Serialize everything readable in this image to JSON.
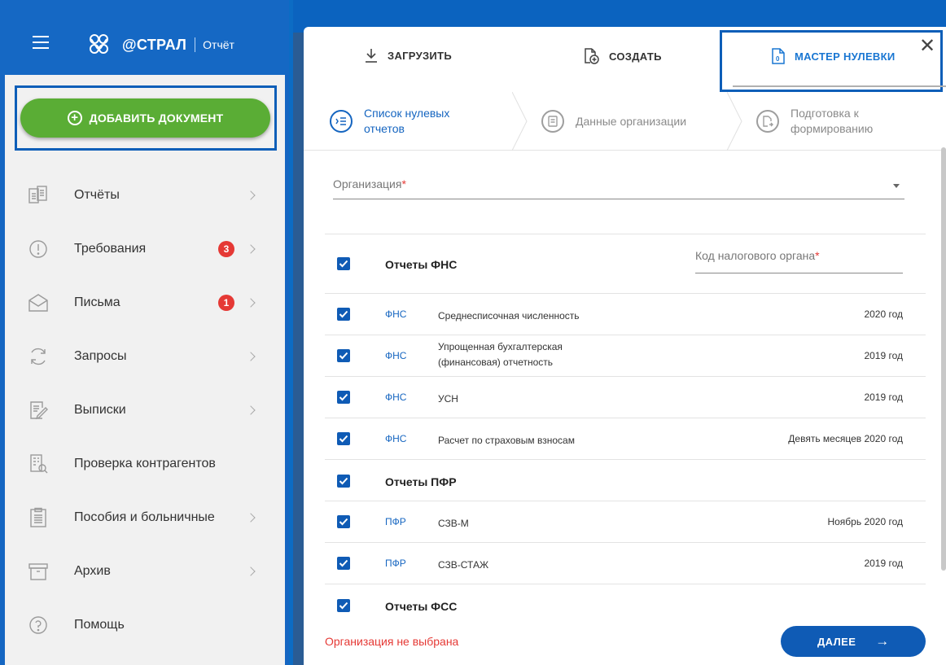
{
  "app": {
    "logo_text": "@СТРАЛ",
    "logo_sub": "Отчёт"
  },
  "sidebar": {
    "add_button_label": "ДОБАВИТЬ ДОКУМЕНТ",
    "items": [
      {
        "label": "Отчёты",
        "icon": "reports-icon",
        "chevron": true
      },
      {
        "label": "Требования",
        "icon": "requirements-icon",
        "badge": "3",
        "chevron": true
      },
      {
        "label": "Письма",
        "icon": "letters-icon",
        "badge": "1",
        "chevron": true
      },
      {
        "label": "Запросы",
        "icon": "requests-icon",
        "chevron": true
      },
      {
        "label": "Выписки",
        "icon": "extracts-icon",
        "chevron": true
      },
      {
        "label": "Проверка контрагентов",
        "icon": "counterparty-check-icon",
        "chevron": false
      },
      {
        "label": "Пособия и больничные",
        "icon": "benefits-icon",
        "chevron": true
      },
      {
        "label": "Архив",
        "icon": "archive-icon",
        "chevron": true
      },
      {
        "label": "Помощь",
        "icon": "help-icon",
        "chevron": false
      }
    ]
  },
  "modal": {
    "tabs": {
      "upload": "ЗАГРУЗИТЬ",
      "create": "СОЗДАТЬ",
      "master": "МАСТЕР НУЛЕВКИ"
    },
    "close": "✕",
    "steps": [
      {
        "line1": "Список нулевых",
        "line2": "отчетов"
      },
      {
        "line1": "Данные организации",
        "line2": ""
      },
      {
        "line1": "Подготовка к",
        "line2": "формированию"
      }
    ],
    "organization_label": "Организация",
    "required_mark": "*",
    "ifns_label": "Код налогового органа",
    "groups": {
      "fns": "Отчеты ФНС",
      "pfr": "Отчеты ПФР",
      "fss": "Отчеты ФСС"
    },
    "reports": [
      {
        "agency": "ФНС",
        "name": "Среднесписочная численность",
        "name2": "",
        "period": "2020 год"
      },
      {
        "agency": "ФНС",
        "name": "Упрощенная бухгалтерская",
        "name2": "(финансовая) отчетность",
        "period": "2019 год"
      },
      {
        "agency": "ФНС",
        "name": "УСН",
        "name2": "",
        "period": "2019 год"
      },
      {
        "agency": "ФНС",
        "name": "Расчет по страховым взносам",
        "name2": "",
        "period": "Девять месяцев 2020 год"
      },
      {
        "agency": "ПФР",
        "name": "СЗВ-М",
        "name2": "",
        "period": "Ноябрь 2020 год"
      },
      {
        "agency": "ПФР",
        "name": "СЗВ-СТАЖ",
        "name2": "",
        "period": "2019 год"
      }
    ],
    "footer_message": "Организация не выбрана",
    "next_button": "ДАЛЕЕ",
    "next_arrow": "→"
  },
  "colors": {
    "brand_blue": "#1566c2",
    "accent_green": "#5aad35",
    "link_blue": "#1565c0",
    "error_red": "#e53935"
  }
}
